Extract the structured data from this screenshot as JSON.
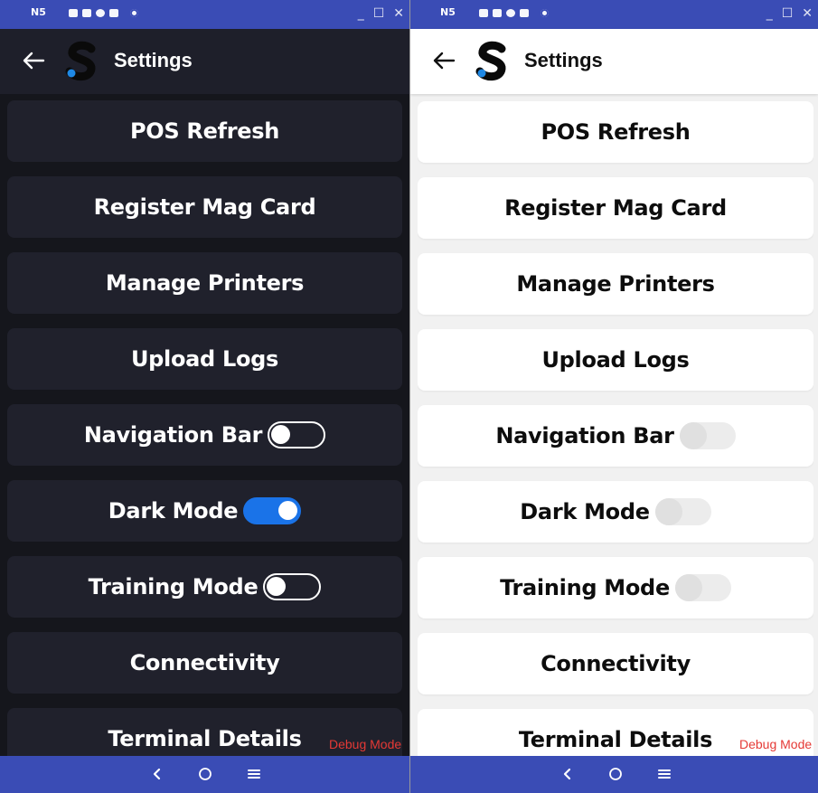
{
  "window": {
    "device_label": "N5",
    "controls": {
      "minimize": "_",
      "maximize": "☐",
      "close": "✕"
    }
  },
  "app": {
    "title": "Settings"
  },
  "settings_items": [
    {
      "label": "POS Refresh"
    },
    {
      "label": "Register Mag Card"
    },
    {
      "label": "Manage Printers"
    },
    {
      "label": "Upload Logs"
    },
    {
      "label": "Navigation Bar"
    },
    {
      "label": "Dark Mode"
    },
    {
      "label": "Training Mode"
    },
    {
      "label": "Connectivity"
    },
    {
      "label": "Terminal Details"
    }
  ],
  "dark_panel": {
    "toggles": {
      "navigation_bar": false,
      "dark_mode": true,
      "training_mode": false
    }
  },
  "light_panel": {
    "toggles": {
      "navigation_bar": false,
      "dark_mode": false,
      "training_mode": false
    }
  },
  "debug_label": "Debug Mode",
  "colors": {
    "window_bar": "#3a4cb5",
    "dark_background": "#15161c",
    "dark_card": "#20212c",
    "light_background": "#f1f1f1",
    "toggle_on": "#1a73e8",
    "debug_text": "#e53935",
    "logo_dot": "#1e88e5"
  },
  "icons": {
    "back": "arrow-left-icon",
    "logo": "s-logo-icon",
    "nav_back": "chevron-left-icon",
    "nav_home": "circle-home-icon",
    "nav_menu": "hamburger-menu-icon"
  }
}
